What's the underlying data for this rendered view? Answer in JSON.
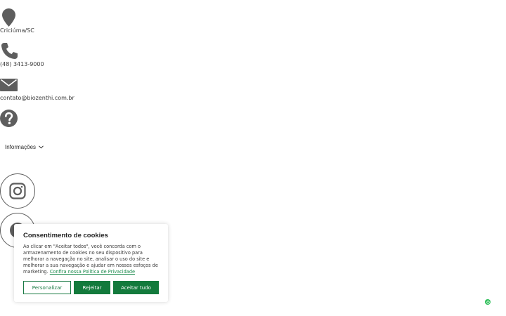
{
  "contact": {
    "location_text": "Criciúma/SC",
    "phone_text": "(48) 3413-9000",
    "email_text": "contato@biozenthi.com.br"
  },
  "menu": {
    "info_label": "Informações"
  },
  "social": {
    "icons": [
      "instagram-icon",
      "facebook-icon"
    ]
  },
  "cookie": {
    "title": "Consentimento de cookies",
    "body": "Ao clicar em \"Aceitar todos\", você concorda com o armazenamento de cookies no seu dispositivo para melhorar a navegação no site, analisar o uso do site e melhorar a sua navegação e ajudar em nossos esfoços de marketing.",
    "link_text": "Confira nossa Política de Privacidade",
    "customize_label": "Personalizar",
    "reject_label": "Rejeitar",
    "accept_label": "Aceitar tudo"
  },
  "colors": {
    "accent": "#137a3c",
    "icon": "#5e5e5e",
    "badge": "#2fbf5a"
  }
}
